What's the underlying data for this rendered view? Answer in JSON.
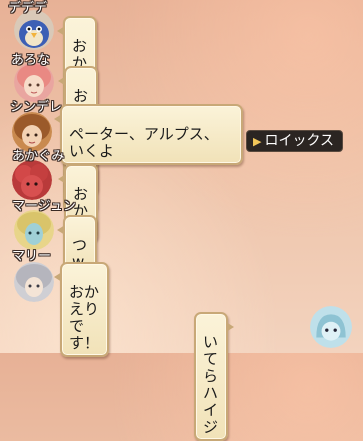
{
  "messages": [
    {
      "name": "デデデ",
      "text": "おかえりなさいー＾＾",
      "avatar": "blue-bird-avatar"
    },
    {
      "name": "あろな",
      "text": "おかえりです",
      "avatar": "pink-hair-girl-avatar"
    },
    {
      "name": "シンデレ",
      "text": "ペーター、アルプス、\nいくよ",
      "avatar": "brown-hair-avatar"
    },
    {
      "name": "あかぐみ",
      "text": "おかw",
      "avatar": "red-fluffy-avatar"
    },
    {
      "name": "マージュン",
      "text": "つw",
      "avatar": "blonde-elf-avatar"
    },
    {
      "name": "マリー",
      "text": "おかえりです！",
      "avatar": "silver-hair-avatar"
    }
  ],
  "own_message": {
    "text": "いてらハイジ",
    "avatar": "blue-ghost-avatar"
  },
  "whisper_tag": {
    "label": "ロイックス",
    "icon": "play-triangle-icon"
  },
  "colors": {
    "bubble_fill": "#f1e2b8",
    "bubble_border": "#c8a877",
    "name_text": "#ffffff",
    "whisper_bg": "#2b2522",
    "background": "#eec3a9"
  }
}
